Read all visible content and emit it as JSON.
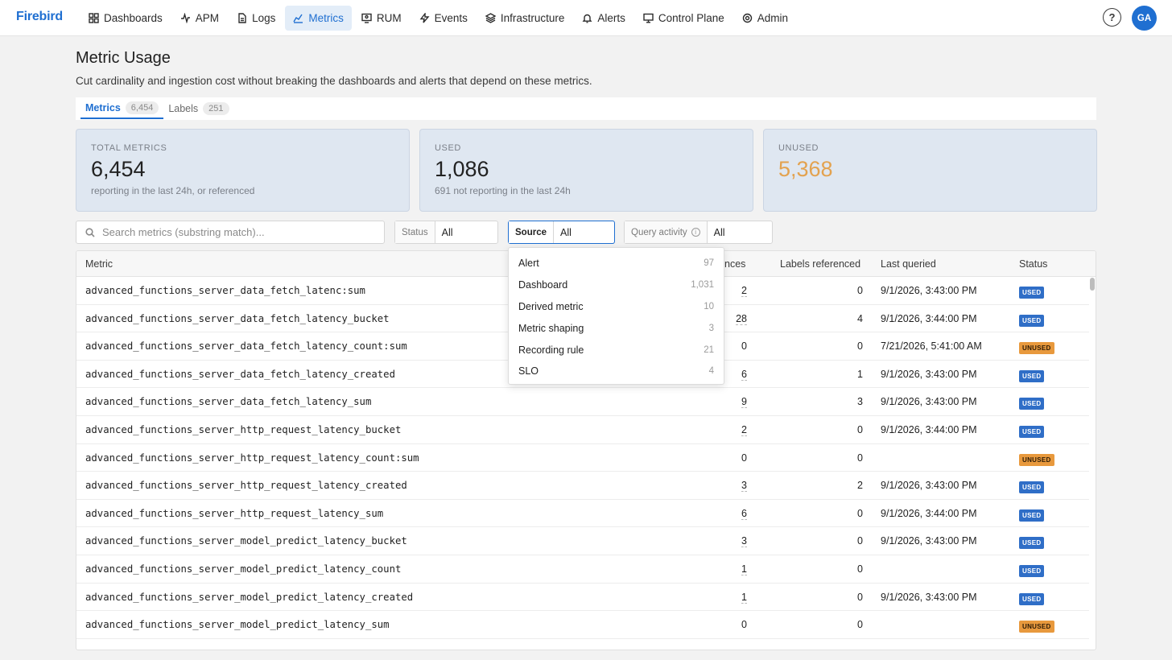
{
  "app": {
    "brand": "Firebird"
  },
  "nav": [
    {
      "label": "Dashboards",
      "icon": "grid-icon",
      "active": false
    },
    {
      "label": "APM",
      "icon": "pulse-icon",
      "active": false
    },
    {
      "label": "Logs",
      "icon": "file-icon",
      "active": false
    },
    {
      "label": "Metrics",
      "icon": "chart-icon",
      "active": true
    },
    {
      "label": "RUM",
      "icon": "monitor-user-icon",
      "active": false
    },
    {
      "label": "Events",
      "icon": "bolt-icon",
      "active": false
    },
    {
      "label": "Infrastructure",
      "icon": "layers-icon",
      "active": false
    },
    {
      "label": "Alerts",
      "icon": "bell-icon",
      "active": false
    },
    {
      "label": "Control Plane",
      "icon": "desktop-icon",
      "active": false
    },
    {
      "label": "Admin",
      "icon": "gear-icon",
      "active": false
    }
  ],
  "header": {
    "help": "?",
    "avatar": "GA"
  },
  "page": {
    "title": "Metric Usage",
    "subtitle": "Cut cardinality and ingestion cost without breaking the dashboards and alerts that depend on these metrics."
  },
  "tabs": [
    {
      "label": "Metrics",
      "count": "6,454",
      "active": true
    },
    {
      "label": "Labels",
      "count": "251",
      "active": false
    }
  ],
  "cards": [
    {
      "label": "TOTAL METRICS",
      "value": "6,454",
      "note": "reporting in the last 24h, or referenced"
    },
    {
      "label": "USED",
      "value": "1,086",
      "note": "691 not reporting in the last 24h"
    },
    {
      "label": "UNUSED",
      "value": "5,368",
      "note": ""
    }
  ],
  "colors": {
    "accent": "#1f6fd1",
    "used": "#2f6ec7",
    "unused": "#e8993d",
    "unused_value": "#e3a24f"
  },
  "filters": {
    "search_placeholder": "Search metrics (substring match)...",
    "status": {
      "label": "Status",
      "value": "All"
    },
    "source": {
      "label": "Source",
      "value": "All"
    },
    "query_activity": {
      "label": "Query activity",
      "value": "All"
    }
  },
  "source_options": [
    {
      "label": "Alert",
      "count": "97"
    },
    {
      "label": "Dashboard",
      "count": "1,031"
    },
    {
      "label": "Derived metric",
      "count": "10"
    },
    {
      "label": "Metric shaping",
      "count": "3"
    },
    {
      "label": "Recording rule",
      "count": "21"
    },
    {
      "label": "SLO",
      "count": "4"
    }
  ],
  "table": {
    "columns": {
      "metric": "Metric",
      "references": "nces",
      "labels": "Labels referenced",
      "last_queried": "Last queried",
      "status": "Status"
    },
    "rows": [
      {
        "metric": "advanced_functions_server_data_fetch_latenc:sum",
        "references": "2",
        "labels": "0",
        "last_queried": "9/1/2026, 3:43:00 PM",
        "status": "USED"
      },
      {
        "metric": "advanced_functions_server_data_fetch_latency_bucket",
        "references": "28",
        "labels": "4",
        "last_queried": "9/1/2026, 3:44:00 PM",
        "status": "USED"
      },
      {
        "metric": "advanced_functions_server_data_fetch_latency_count:sum",
        "references": "0",
        "labels": "0",
        "last_queried": "7/21/2026, 5:41:00 AM",
        "status": "UNUSED"
      },
      {
        "metric": "advanced_functions_server_data_fetch_latency_created",
        "references": "6",
        "labels": "1",
        "last_queried": "9/1/2026, 3:43:00 PM",
        "status": "USED"
      },
      {
        "metric": "advanced_functions_server_data_fetch_latency_sum",
        "references": "9",
        "labels": "3",
        "last_queried": "9/1/2026, 3:43:00 PM",
        "status": "USED"
      },
      {
        "metric": "advanced_functions_server_http_request_latency_bucket",
        "references": "2",
        "labels": "0",
        "last_queried": "9/1/2026, 3:44:00 PM",
        "status": "USED"
      },
      {
        "metric": "advanced_functions_server_http_request_latency_count:sum",
        "references": "0",
        "labels": "0",
        "last_queried": "",
        "status": "UNUSED"
      },
      {
        "metric": "advanced_functions_server_http_request_latency_created",
        "references": "3",
        "labels": "2",
        "last_queried": "9/1/2026, 3:43:00 PM",
        "status": "USED"
      },
      {
        "metric": "advanced_functions_server_http_request_latency_sum",
        "references": "6",
        "labels": "0",
        "last_queried": "9/1/2026, 3:44:00 PM",
        "status": "USED"
      },
      {
        "metric": "advanced_functions_server_model_predict_latency_bucket",
        "references": "3",
        "labels": "0",
        "last_queried": "9/1/2026, 3:43:00 PM",
        "status": "USED"
      },
      {
        "metric": "advanced_functions_server_model_predict_latency_count",
        "references": "1",
        "labels": "0",
        "last_queried": "",
        "status": "USED"
      },
      {
        "metric": "advanced_functions_server_model_predict_latency_created",
        "references": "1",
        "labels": "0",
        "last_queried": "9/1/2026, 3:43:00 PM",
        "status": "USED"
      },
      {
        "metric": "advanced_functions_server_model_predict_latency_sum",
        "references": "0",
        "labels": "0",
        "last_queried": "",
        "status": "UNUSED"
      }
    ]
  }
}
